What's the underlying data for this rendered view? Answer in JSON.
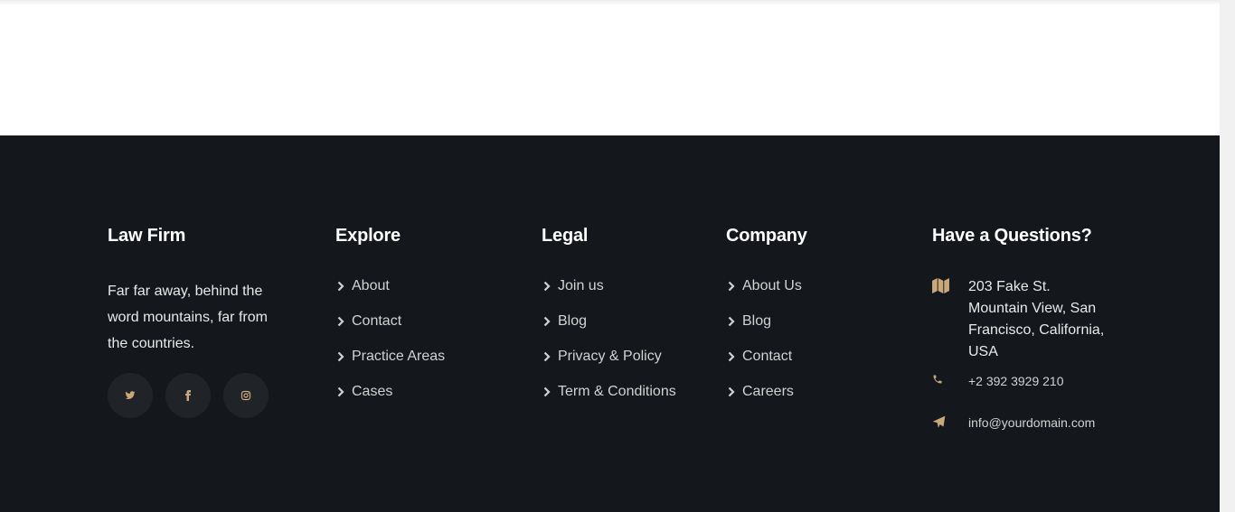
{
  "footer": {
    "about": {
      "title": "Law Firm",
      "text": "Far far away, behind the word mountains, far from the countries.",
      "social": [
        {
          "icon": "twitter-icon"
        },
        {
          "icon": "facebook-icon"
        },
        {
          "icon": "instagram-icon"
        }
      ]
    },
    "explore": {
      "title": "Explore",
      "links": [
        "About",
        "Contact",
        "Practice Areas",
        "Cases"
      ]
    },
    "legal": {
      "title": "Legal",
      "links": [
        "Join us",
        "Blog",
        "Privacy & Policy",
        "Term & Conditions"
      ]
    },
    "company": {
      "title": "Company",
      "links": [
        "About Us",
        "Blog",
        "Contact",
        "Careers"
      ]
    },
    "contact": {
      "title": "Have a Questions?",
      "address": "203 Fake St. Mountain View, San Francisco, California, USA",
      "phone": "+2 392 3929 210",
      "email": "info@yourdomain.com"
    }
  },
  "colors": {
    "background": "#14171b",
    "accent": "#c9a97a",
    "social_bg": "#202328",
    "heading": "#ffffff",
    "text": "#d2d2d2"
  },
  "icons": {
    "address": "map-icon",
    "phone": "phone-icon",
    "email": "paper-plane-icon",
    "link_bullet": "chevron-right-icon"
  }
}
